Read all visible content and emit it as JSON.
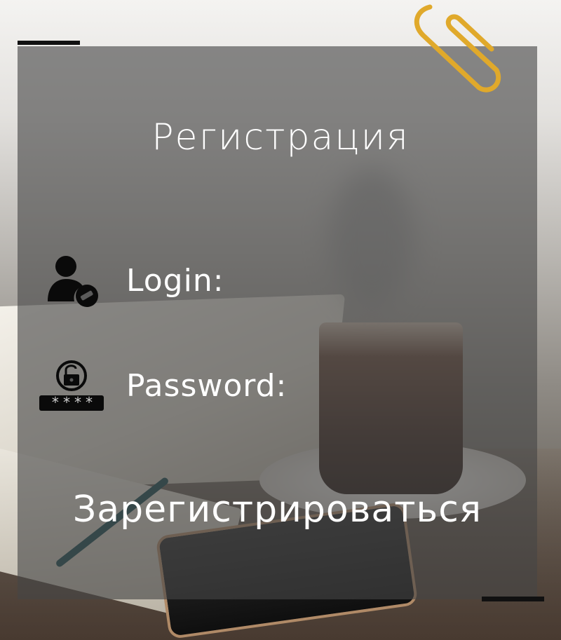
{
  "form": {
    "title": "Регистрация",
    "login_label": "Login:",
    "password_label": "Password:",
    "password_mask": "****",
    "register_label": "Зарегистрироваться"
  },
  "colors": {
    "accent": "#e0a92b",
    "text": "#ffffff",
    "panel": "#464646"
  },
  "icons": {
    "user": "user-edit-icon",
    "password": "lock-password-icon",
    "paperclip": "paperclip-icon"
  }
}
